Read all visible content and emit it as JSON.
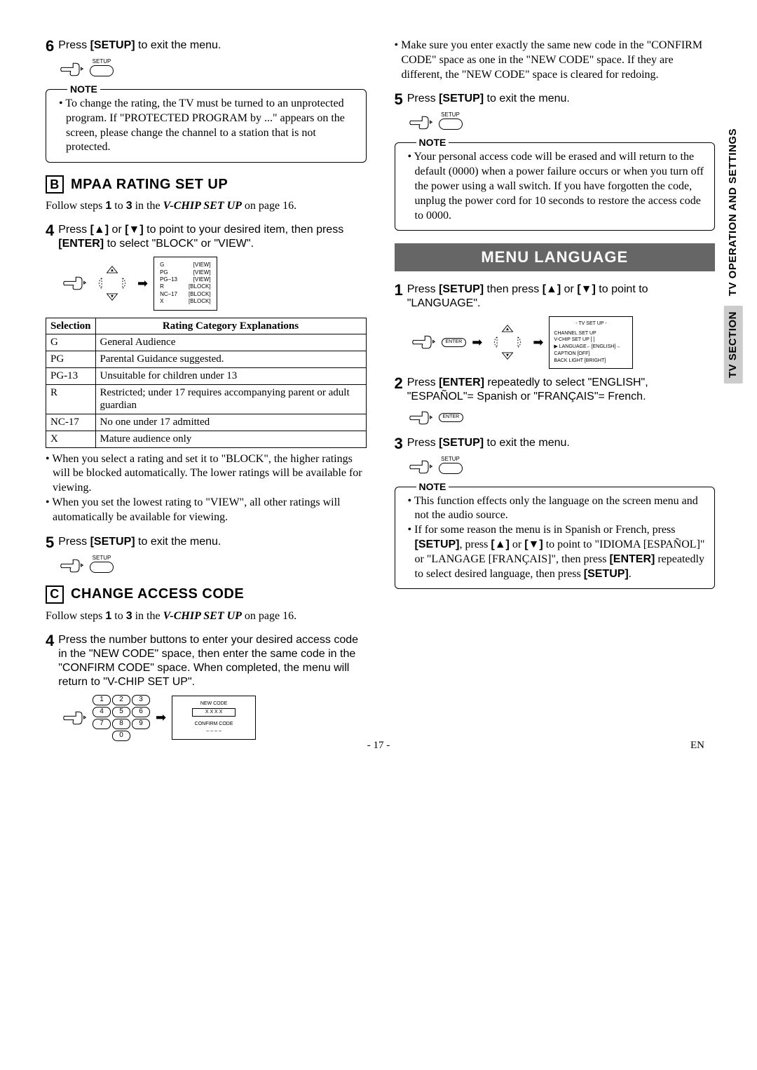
{
  "sideTab": {
    "upper": "TV OPERATION AND SETTINGS",
    "lower": "TV SECTION"
  },
  "left": {
    "step6": {
      "num": "6",
      "text_a": "Press ",
      "setup": "[SETUP]",
      "text_b": " to exit the menu."
    },
    "setupLabel": "SETUP",
    "note1": "To change the rating, the TV must be turned to an unprotected program. If \"PROTECTED PROGRAM by ...\" appears on the screen, please change the channel to a station that is not protected.",
    "sectionB": {
      "letter": "B",
      "title": "MPAA RATING SET UP"
    },
    "followB": {
      "a": "Follow steps ",
      "n1": "1",
      "mid": " to ",
      "n3": "3",
      "b": " in the ",
      "bold": "V-CHIP SET UP",
      "c": " on page 16."
    },
    "step4B": {
      "num": "4",
      "a": "Press ",
      "b": " or ",
      "c": " to point to your desired item, then press ",
      "enter": "[ENTER]",
      "d": " to select \"BLOCK\" or \"VIEW\"."
    },
    "ratingDiagram": {
      "rows": [
        {
          "l": "G",
          "r": "[VIEW]"
        },
        {
          "l": "PG",
          "r": "[VIEW]"
        },
        {
          "l": "PG–13",
          "r": "[VIEW]"
        },
        {
          "l": "R",
          "r": "[BLOCK]"
        },
        {
          "l": "NC–17",
          "r": "[BLOCK]"
        },
        {
          "l": "X",
          "r": "[BLOCK]"
        }
      ]
    },
    "tableHead": {
      "c1": "Selection",
      "c2": "Rating Category Explanations"
    },
    "tableRows": [
      {
        "s": "G",
        "e": "General Audience"
      },
      {
        "s": "PG",
        "e": "Parental Guidance suggested."
      },
      {
        "s": "PG-13",
        "e": "Unsuitable for children under 13"
      },
      {
        "s": "R",
        "e": "Restricted; under 17 requires accompanying parent or adult guardian"
      },
      {
        "s": "NC-17",
        "e": "No one under 17 admitted"
      },
      {
        "s": "X",
        "e": "Mature audience only"
      }
    ],
    "bulletsB": [
      "When you select a rating and set it to \"BLOCK\", the higher ratings will be blocked automatically. The lower ratings will be available for viewing.",
      "When you set the lowest rating to \"VIEW\", all other ratings will automatically be available for viewing."
    ],
    "step5B": {
      "num": "5",
      "a": "Press ",
      "setup": "[SETUP]",
      "b": " to exit the menu."
    },
    "sectionC": {
      "letter": "C",
      "title": "CHANGE ACCESS CODE"
    },
    "followC": {
      "a": "Follow steps ",
      "n1": "1",
      "mid": " to ",
      "n3": "3",
      "b": " in the ",
      "bold": "V-CHIP SET UP",
      "c": " on page 16."
    },
    "step4C": {
      "num": "4",
      "text": "Press the number buttons to enter your desired access code in the \"NEW CODE\" space, then enter the same code in the \"CONFIRM CODE\" space. When completed, the menu will return to \"V-CHIP SET UP\"."
    },
    "keypad": [
      "1",
      "2",
      "3",
      "4",
      "5",
      "6",
      "7",
      "8",
      "9"
    ],
    "key0": "0",
    "codeDiagram": {
      "new": "NEW CODE",
      "newVal": "X X X X",
      "confirm": "CONFIRM CODE",
      "confirmVal": "– – – –"
    }
  },
  "right": {
    "bulletTop": "Make sure you enter exactly the same new code in the \"CONFIRM CODE\" space as one in the \"NEW CODE\" space. If they are different, the \"NEW CODE\" space is cleared for redoing.",
    "step5R": {
      "num": "5",
      "a": "Press ",
      "setup": "[SETUP]",
      "b": " to exit the menu."
    },
    "setupLabel": "SETUP",
    "note2": "Your personal access code will be erased and will return to the default (0000) when a power failure occurs or when you turn off the power using a wall switch. If you have forgotten the code, unplug the power cord for 10 seconds to restore the access code to 0000.",
    "banner": "MENU LANGUAGE",
    "step1": {
      "num": "1",
      "a": "Press ",
      "setup": "[SETUP]",
      "b": " then press ",
      "c": " or ",
      "d": " to point to \"LANGUAGE\"."
    },
    "enterLabel": "ENTER",
    "osd": {
      "title": "- TV SET UP -",
      "lines": [
        "CHANNEL SET UP",
        "V-CHIP SET UP [        ]",
        "▶ LANGUAGE←[ENGLISH]→",
        "CAPTION        [OFF]",
        "BACK LIGHT  [BRIGHT]"
      ]
    },
    "step2": {
      "num": "2",
      "a": "Press ",
      "enter": "[ENTER]",
      "b": " repeatedly to select \"ENGLISH\", \"ESPAÑOL\"= Spanish or \"FRANÇAIS\"= French."
    },
    "step3": {
      "num": "3",
      "a": "Press ",
      "setup": "[SETUP]",
      "b": " to exit the menu."
    },
    "note3": [
      "This function effects only the language on the screen menu and not the audio source.",
      "If for some reason the menu is in Spanish or French, press [SETUP], press [▲] or [▼] to point to \"IDIOMA [ESPAÑOL]\" or \"LANGAGE [FRANÇAIS]\", then press [ENTER] repeatedly to select desired language, then press [SETUP]."
    ],
    "note3_item2": {
      "a": "If for some reason the menu is in Spanish or French, press ",
      "setup1": "[SETUP]",
      "b": ", press ",
      "c": " or ",
      "d": " to point to \"IDIOMA [ESPAÑOL]\" or \"LANGAGE [FRANÇAIS]\", then press ",
      "enter": "[ENTER]",
      "e": " repeatedly to select desired language, then press ",
      "setup2": "[SETUP]",
      "f": "."
    }
  },
  "footer": {
    "page": "- 17 -",
    "lang": "EN"
  },
  "noteLabel": "NOTE",
  "upArrow": "[▲]",
  "downArrow": "[▼]"
}
